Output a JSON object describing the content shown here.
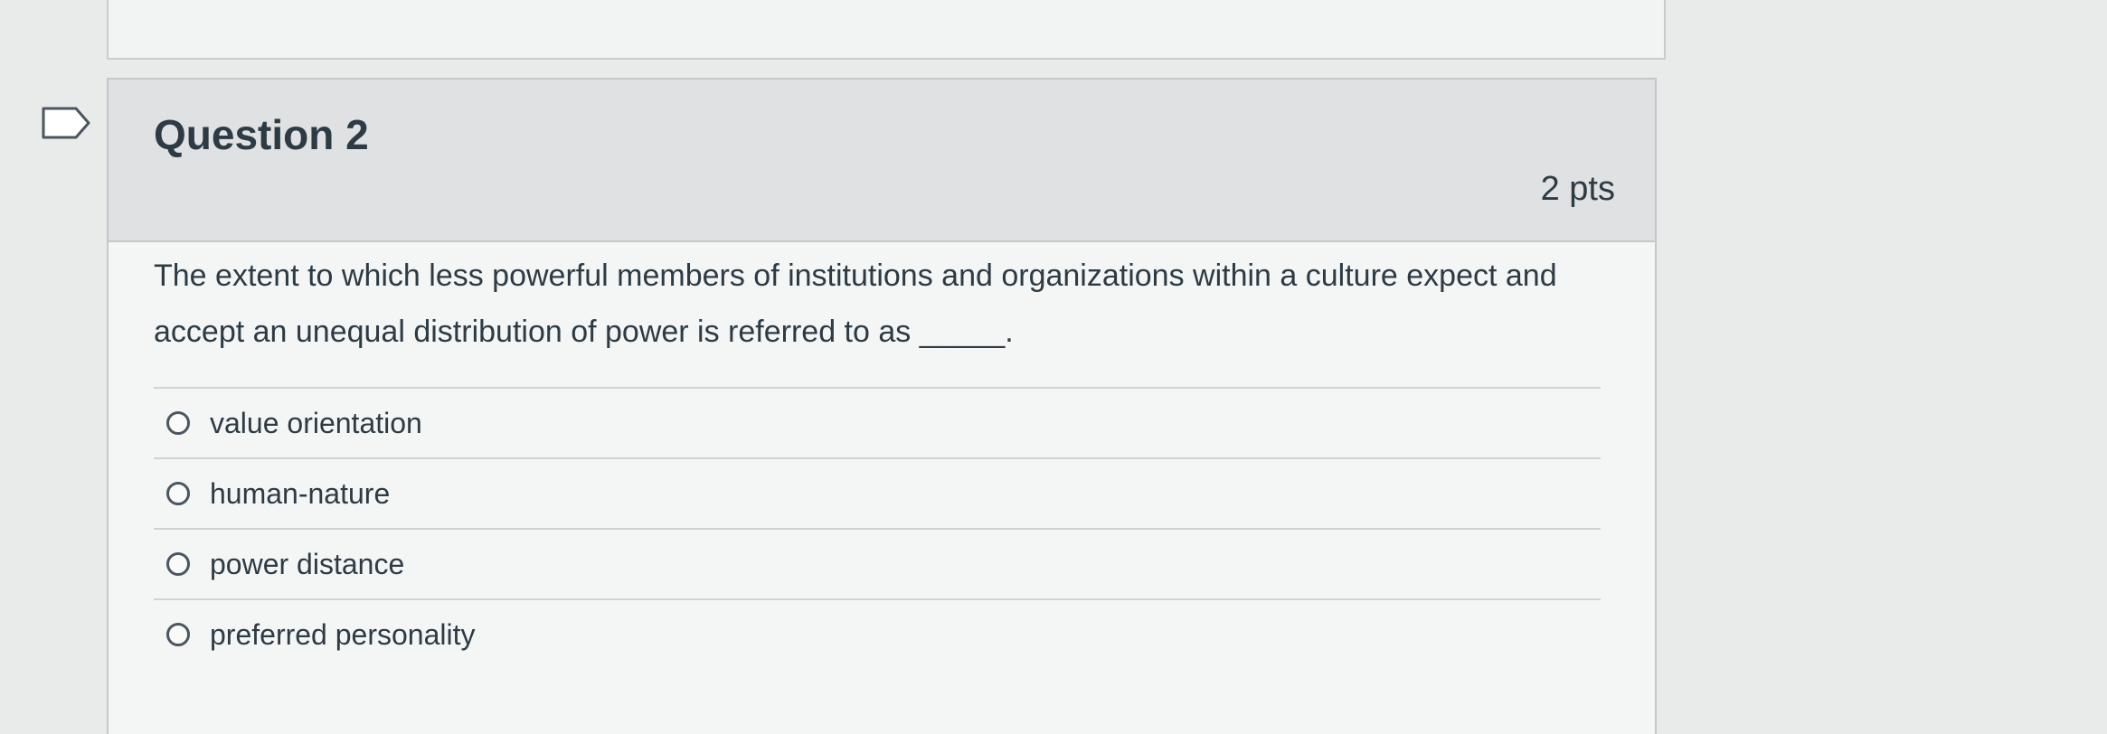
{
  "question": {
    "title": "Question 2",
    "points": "2 pts",
    "text": "The extent to which less powerful members of institutions and organizations within a culture expect and accept an unequal distribution of power is referred to as _____.",
    "answers": [
      {
        "label": "value orientation"
      },
      {
        "label": "human-nature"
      },
      {
        "label": "power distance"
      },
      {
        "label": "preferred personality"
      }
    ]
  },
  "icons": {
    "flag": "flag-question-icon",
    "radio": "radio-unselected-icon"
  },
  "colors": {
    "header_bg": "#dfe1e2",
    "card_bg": "#f4f5f5",
    "text": "#2d3b45",
    "border": "#c4c8cb"
  }
}
